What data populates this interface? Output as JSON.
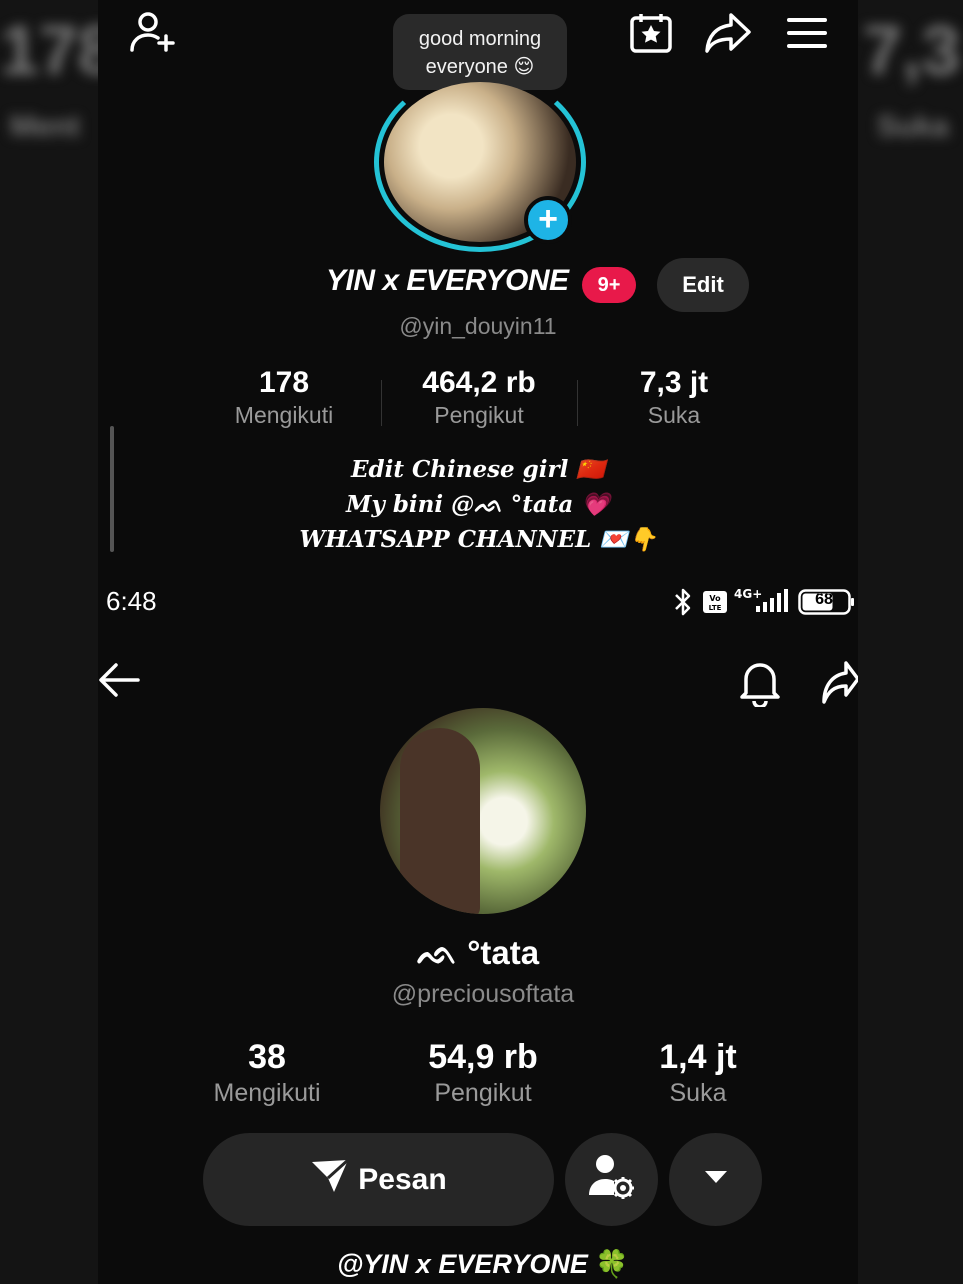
{
  "overlay": {
    "bubble_line1": "good morning",
    "bubble_line2": "everyone 😌",
    "name": "YIN x EVERYONE",
    "badge": "9+",
    "edit_label": "Edit",
    "handle": "@yin_douyin11",
    "stats": [
      {
        "value": "178",
        "label": "Mengikuti"
      },
      {
        "value": "464,2 rb",
        "label": "Pengikut"
      },
      {
        "value": "7,3 jt",
        "label": "Suka"
      }
    ],
    "bio": [
      "Edit Chinese girl 🇨🇳",
      "My bini @ᨒ °tata 💗",
      "WHATSAPP CHANNEL 💌👇"
    ]
  },
  "status_bar": {
    "time": "6:48",
    "battery": "68"
  },
  "profile": {
    "name": "ᨒ °tata",
    "handle": "@preciousoftata",
    "stats": [
      {
        "value": "38",
        "label": "Mengikuti"
      },
      {
        "value": "54,9 rb",
        "label": "Pengikut"
      },
      {
        "value": "1,4 jt",
        "label": "Suka"
      }
    ],
    "message_label": "Pesan",
    "footer_text": "@YIN x EVERYONE",
    "footer_emoji": "🍀"
  },
  "colors": {
    "background": "#0b0b0b",
    "accent_cyan": "#1eb4e6",
    "badge_red": "#e8194a",
    "button_gray": "#262626"
  },
  "icons": [
    "add-friend-icon",
    "calendar-star-icon",
    "share-icon",
    "menu-icon",
    "plus-icon",
    "bluetooth-icon",
    "volte-icon",
    "signal-icon",
    "battery-icon",
    "back-arrow-icon",
    "bell-icon",
    "send-icon",
    "person-settings-icon",
    "chevron-down-icon"
  ]
}
